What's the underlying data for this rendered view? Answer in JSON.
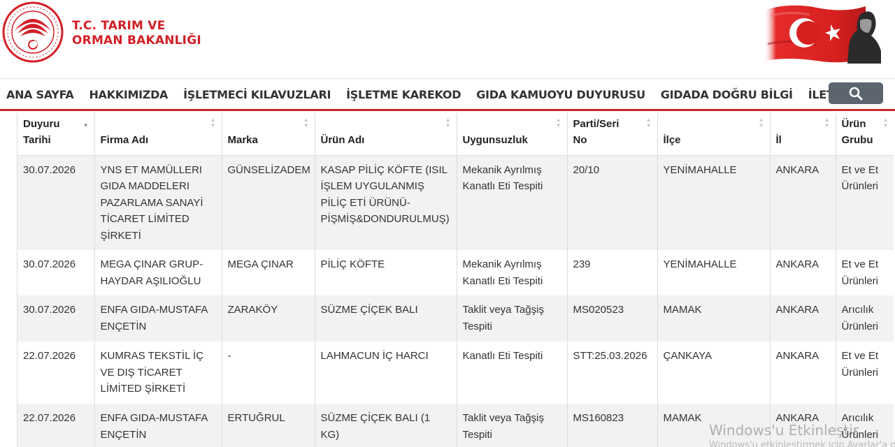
{
  "header": {
    "ministry_line1": "T.C. TARIM VE",
    "ministry_line2": "ORMAN BAKANLIĞI",
    "brand_color": "#d21f26"
  },
  "nav": {
    "items": [
      "ANA SAYFA",
      "HAKKIMIZDA",
      "İŞLETMECİ KILAVUZLARI",
      "İŞLETME KAREKOD",
      "GIDA KAMUOYU DUYURUSU",
      "GIDADA DOĞRU BİLGİ",
      "İLETİŞİM"
    ],
    "search_icon": "search-icon"
  },
  "table": {
    "columns": [
      {
        "line1": "Duyuru",
        "line2": "Tarihi"
      },
      {
        "line1": "",
        "line2": "Firma Adı"
      },
      {
        "line1": "",
        "line2": "Marka"
      },
      {
        "line1": "",
        "line2": "Ürün Adı"
      },
      {
        "line1": "",
        "line2": "Uygunsuzluk"
      },
      {
        "line1": "Parti/Seri",
        "line2": "No"
      },
      {
        "line1": "",
        "line2": "İlçe"
      },
      {
        "line1": "",
        "line2": "İl"
      },
      {
        "line1": "Ürün",
        "line2": "Grubu"
      }
    ],
    "rows": [
      [
        "30.07.2026",
        "YNS ET MAMÜLLERI GIDA MADDELERI PAZARLAMA SANAYİ TİCARET LİMİTED ŞİRKETİ",
        "GÜNSELİZADEM",
        "KASAP PİLİÇ KÖFTE (ISIL İŞLEM UYGULANMIŞ PİLİÇ ETİ ÜRÜNÜ-PİŞMİŞ&DONDURULMUŞ)",
        "Mekanik Ayrılmış Kanatlı Eti Tespiti",
        "20/10",
        "YENİMAHALLE",
        "ANKARA",
        "Et ve Et Ürünleri"
      ],
      [
        "30.07.2026",
        "MEGA ÇINAR GRUP-HAYDAR AŞILIOĞLU",
        "MEGA ÇINAR",
        "PİLİÇ KÖFTE",
        "Mekanik Ayrılmış Kanatlı Eti Tespiti",
        "239",
        "YENİMAHALLE",
        "ANKARA",
        "Et ve Et Ürünleri"
      ],
      [
        "30.07.2026",
        "ENFA GIDA-MUSTAFA ENÇETİN",
        "ZARAKÖY",
        "SÜZME ÇİÇEK BALI",
        "Taklit veya Tağşiş Tespiti",
        "MS020523",
        "MAMAK",
        "ANKARA",
        "Arıcılık Ürünleri"
      ],
      [
        "22.07.2026",
        "KUMRAS TEKSTİL İÇ VE DIŞ TİCARET LİMİTED ŞİRKETİ",
        "-",
        "LAHMACUN İÇ HARCI",
        "Kanatlı Eti Tespiti",
        "STT:25.03.2026",
        "ÇANKAYA",
        "ANKARA",
        "Et ve Et Ürünleri"
      ],
      [
        "22.07.2026",
        "ENFA GIDA-MUSTAFA ENÇETİN",
        "ERTUĞRUL",
        "SÜZME ÇİÇEK BALI (1 KG)",
        "Taklit veya Tağşiş Tespiti",
        "MS160823",
        "MAMAK",
        "ANKARA",
        "Arıcılık Ürünleri"
      ]
    ]
  },
  "watermark": {
    "line1": "Windows'u Etkinleştir",
    "line2": "Windows'u etkinleştirmek için Ayarlar'a gidin."
  }
}
